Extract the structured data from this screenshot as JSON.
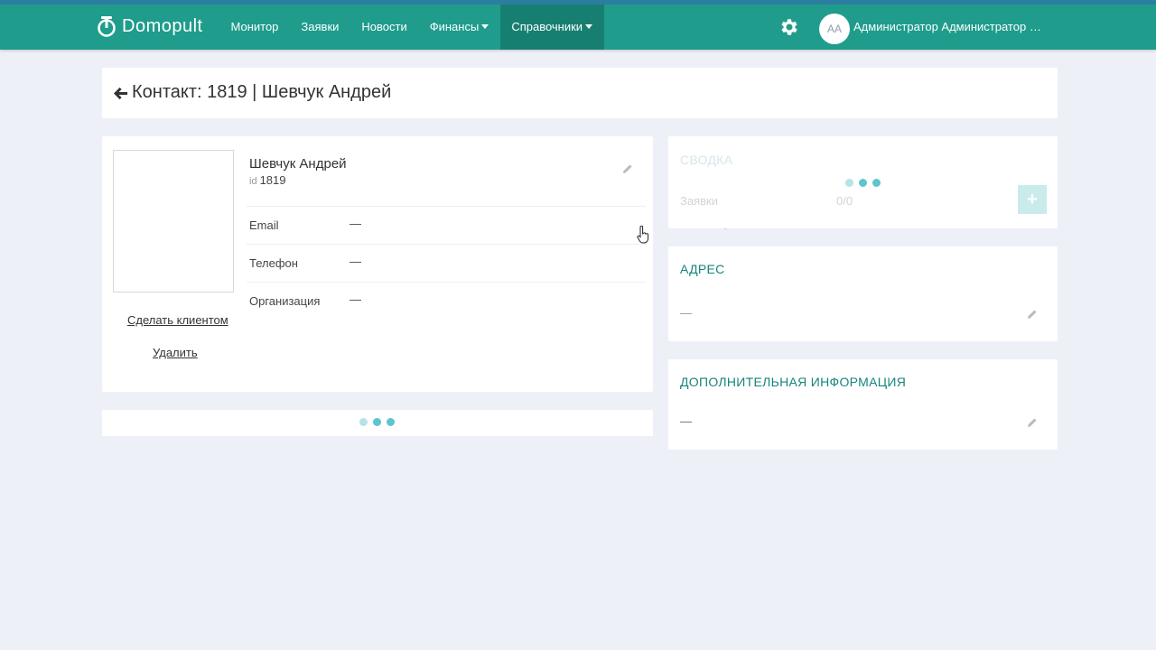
{
  "brand": {
    "name": "Domopult"
  },
  "nav": {
    "items": [
      {
        "label": "Монитор",
        "dropdown": false,
        "active": false
      },
      {
        "label": "Заявки",
        "dropdown": false,
        "active": false
      },
      {
        "label": "Новости",
        "dropdown": false,
        "active": false
      },
      {
        "label": "Финансы",
        "dropdown": true,
        "active": false
      },
      {
        "label": "Справочники",
        "dropdown": true,
        "active": true
      }
    ]
  },
  "user": {
    "initials": "AA",
    "name": "Администратор Администратор Администратор"
  },
  "page": {
    "title": "Контакт: 1819 | Шевчук Андрей"
  },
  "contact": {
    "name": "Шевчук Андрей",
    "id_label": "id",
    "id": "1819",
    "make_client_label": "Сделать клиентом",
    "delete_label": "Удалить",
    "fields": [
      {
        "label": "Email",
        "value": "—"
      },
      {
        "label": "Телефон",
        "value": "—"
      },
      {
        "label": "Организация",
        "value": "—"
      }
    ]
  },
  "summary": {
    "heading": "СВОДКА",
    "requests_label": "Заявки",
    "requests_value": "0/0",
    "add_label": "+"
  },
  "address": {
    "heading": "АДРЕС",
    "value": "—"
  },
  "extra": {
    "heading": "ДОПОЛНИТЕЛЬНАЯ ИНФОРМАЦИЯ",
    "value": "—"
  },
  "colors": {
    "topbar": "#1f9c8c",
    "nav_active": "#177f72",
    "accent_heading": "#17857a",
    "loader_dot": "#5cc6cd",
    "background": "#eef0f8"
  },
  "icons": {
    "logo": "power-icon",
    "settings": "gear-icon",
    "back": "arrow-left-icon",
    "edit": "pencil-icon"
  }
}
